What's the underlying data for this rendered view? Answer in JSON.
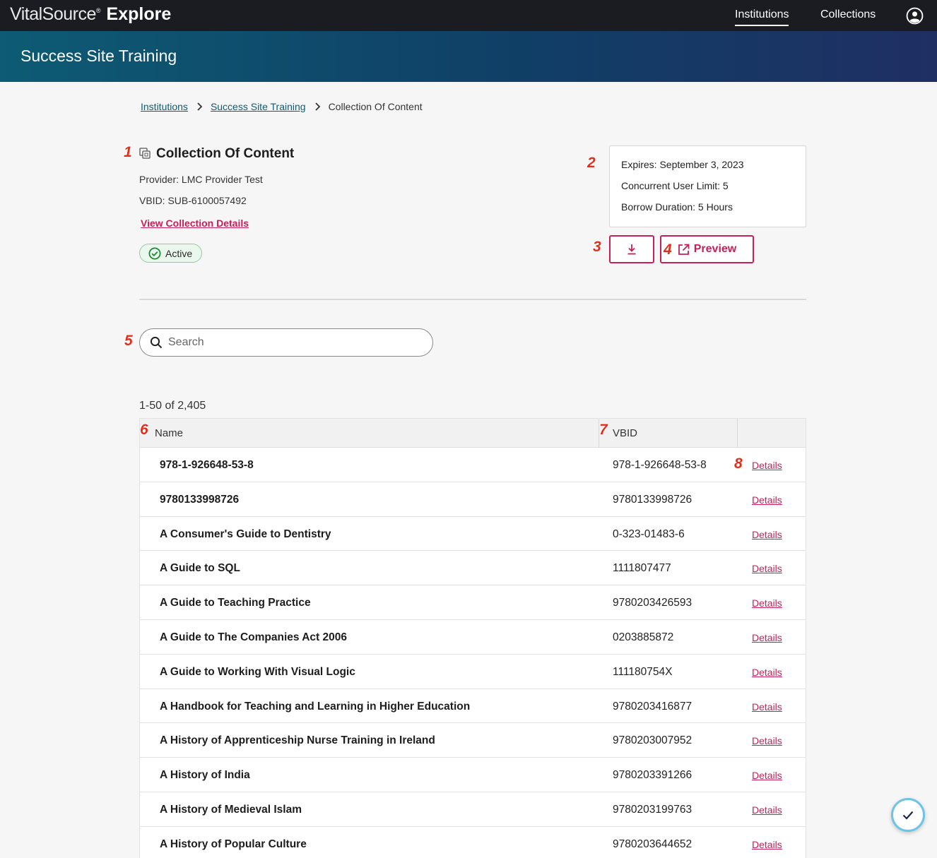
{
  "header": {
    "brand_name": "VitalSource",
    "brand_reg": "®",
    "brand_product": "Explore",
    "nav": [
      {
        "label": "Institutions",
        "active": true
      },
      {
        "label": "Collections",
        "active": false
      }
    ]
  },
  "banner": {
    "title": "Success Site Training"
  },
  "breadcrumb": {
    "items": [
      "Institutions",
      "Success Site Training"
    ],
    "current": "Collection Of Content"
  },
  "collection": {
    "title": "Collection Of Content",
    "provider": "Provider: LMC Provider Test",
    "vbid": "VBID: SUB-6100057492",
    "view_link": "View Collection Details",
    "status": "Active"
  },
  "info": {
    "expires": "Expires: September 3, 2023",
    "concurrent": "Concurrent User Limit: 5",
    "borrow": "Borrow Duration: 5 Hours"
  },
  "actions": {
    "preview_label": "Preview"
  },
  "search": {
    "placeholder": "Search"
  },
  "results": {
    "count": "1-50 of 2,405"
  },
  "table": {
    "columns": {
      "name": "Name",
      "vbid": "VBID"
    },
    "details_label": "Details",
    "rows": [
      {
        "name": "978-1-926648-53-8",
        "vbid": "978-1-926648-53-8"
      },
      {
        "name": "9780133998726",
        "vbid": "9780133998726"
      },
      {
        "name": "A Consumer's Guide to Dentistry",
        "vbid": "0-323-01483-6"
      },
      {
        "name": "A Guide to SQL",
        "vbid": "1111807477"
      },
      {
        "name": "A Guide to Teaching Practice",
        "vbid": "9780203426593"
      },
      {
        "name": "A Guide to The Companies Act 2006",
        "vbid": "0203885872"
      },
      {
        "name": "A Guide to Working With Visual Logic",
        "vbid": "111180754X"
      },
      {
        "name": "A Handbook for Teaching and Learning in Higher Education",
        "vbid": "9780203416877"
      },
      {
        "name": "A History of Apprenticeship Nurse Training in Ireland",
        "vbid": "9780203007952"
      },
      {
        "name": "A History of India",
        "vbid": "9780203391266"
      },
      {
        "name": "A History of Medieval Islam",
        "vbid": "9780203199763"
      },
      {
        "name": "A History of Popular Culture",
        "vbid": "9780203644652"
      }
    ]
  },
  "markers": [
    "1",
    "2",
    "3",
    "4",
    "5",
    "6",
    "7",
    "8"
  ],
  "colors": {
    "accent": "#c72056",
    "link": "#0d5b74",
    "active_green": "#1e8a35",
    "topbar": "#1b1b22"
  }
}
